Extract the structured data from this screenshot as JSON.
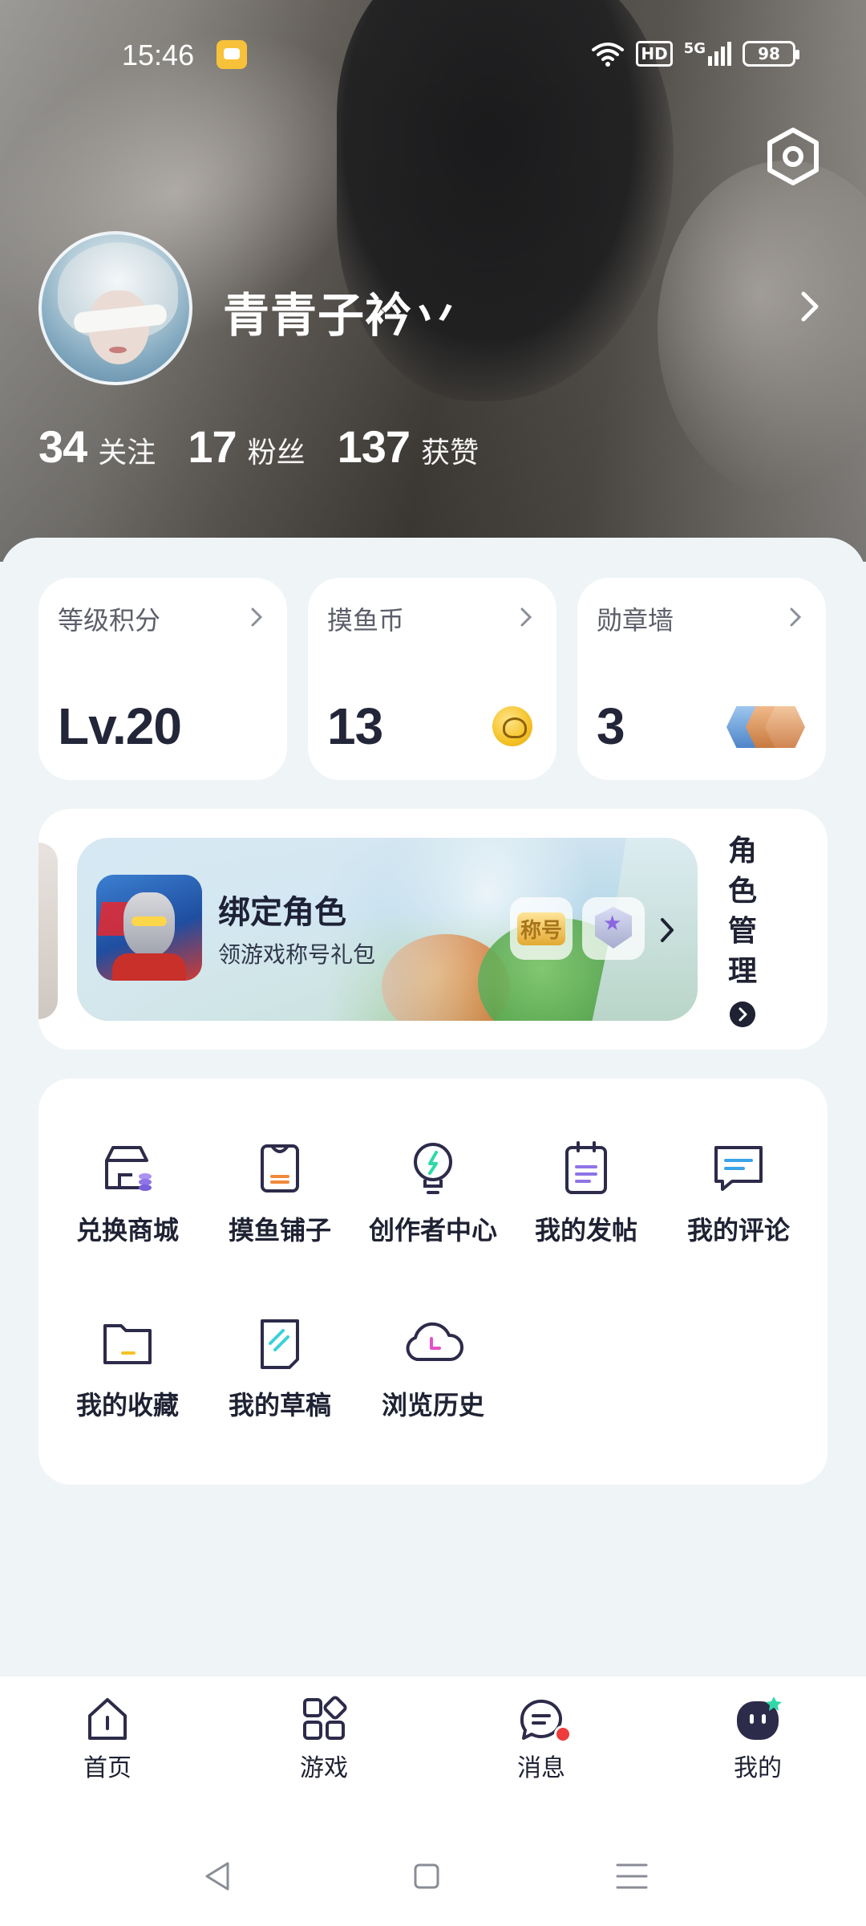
{
  "status_bar": {
    "time": "15:46",
    "network_hd": "HD",
    "network_5g": "5G",
    "battery": "98"
  },
  "profile": {
    "username": "青青子衿丷",
    "stats": [
      {
        "value": "34",
        "label": "关注"
      },
      {
        "value": "17",
        "label": "粉丝"
      },
      {
        "value": "137",
        "label": "获赞"
      }
    ]
  },
  "cards": [
    {
      "title": "等级积分",
      "value": "Lv.20",
      "icon": "chevron-right-icon"
    },
    {
      "title": "摸鱼币",
      "value": "13",
      "icon": "coin-icon"
    },
    {
      "title": "勋章墙",
      "value": "3",
      "icon": "medal-icons"
    }
  ],
  "banner": {
    "title": "绑定角色",
    "subtitle": "领游戏称号礼包",
    "reward_title": "称号",
    "side_label": "角色管理"
  },
  "menu": {
    "items": [
      {
        "label": "兑换商城",
        "icon": "shop-icon"
      },
      {
        "label": "摸鱼铺子",
        "icon": "bag-icon"
      },
      {
        "label": "创作者中心",
        "icon": "bulb-icon"
      },
      {
        "label": "我的发帖",
        "icon": "clipboard-icon"
      },
      {
        "label": "我的评论",
        "icon": "comment-icon"
      },
      {
        "label": "我的收藏",
        "icon": "folder-icon"
      },
      {
        "label": "我的草稿",
        "icon": "draft-icon"
      },
      {
        "label": "浏览历史",
        "icon": "history-icon"
      }
    ]
  },
  "bottom_nav": {
    "items": [
      {
        "label": "首页",
        "icon": "home-icon"
      },
      {
        "label": "游戏",
        "icon": "grid-icon"
      },
      {
        "label": "消息",
        "icon": "message-icon"
      },
      {
        "label": "我的",
        "icon": "profile-icon",
        "active": true
      }
    ]
  },
  "colors": {
    "background": "#eff4f7",
    "text_primary": "#1f2233",
    "accent_purple": "#2d2b4a",
    "notification": "#ee3b3b",
    "accent_green": "#2fd8a8"
  }
}
